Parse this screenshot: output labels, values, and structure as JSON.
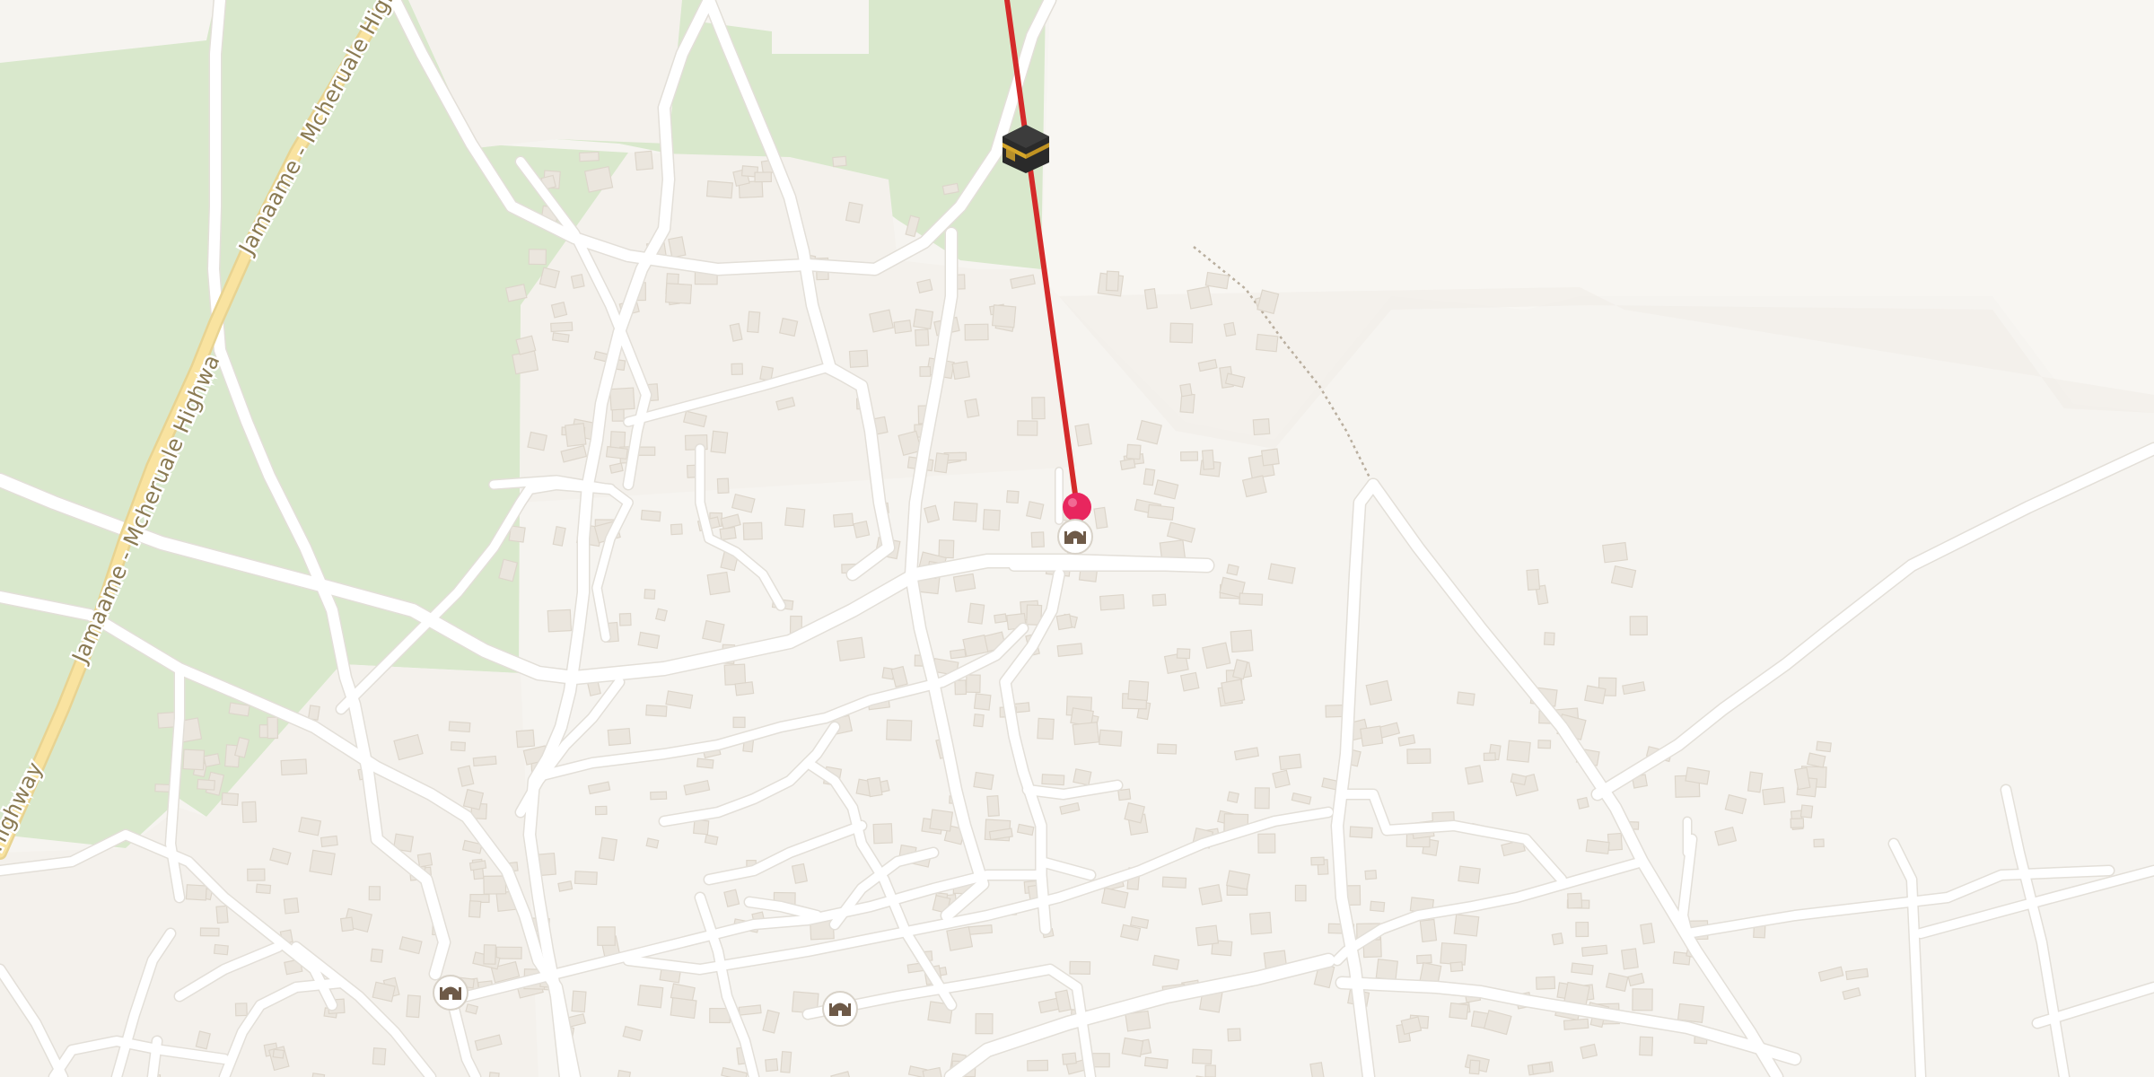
{
  "map": {
    "road_labels": [
      {
        "id": "highway-label-1",
        "text": "Jamaame - Mcheruale Highway"
      },
      {
        "id": "highway-label-2",
        "text": "Jamaame - Mcheruale Highway"
      },
      {
        "id": "highway-label-3",
        "text": "Highway"
      }
    ],
    "markers": {
      "kaaba": {
        "icon": "kaaba-icon"
      },
      "location_pin": {
        "icon": "map-pin-icon",
        "color": "#e8265e"
      },
      "mosques": [
        {
          "icon": "mosque-icon"
        },
        {
          "icon": "mosque-icon"
        },
        {
          "icon": "mosque-icon"
        }
      ]
    },
    "qibla_line": {
      "color": "#d42a2a"
    },
    "colors": {
      "land": "#f6f4f0",
      "vegetation": "#d9e8cc",
      "road": "#ffffff",
      "highway": "#f9e3a0",
      "building": "#ebe6de"
    }
  }
}
